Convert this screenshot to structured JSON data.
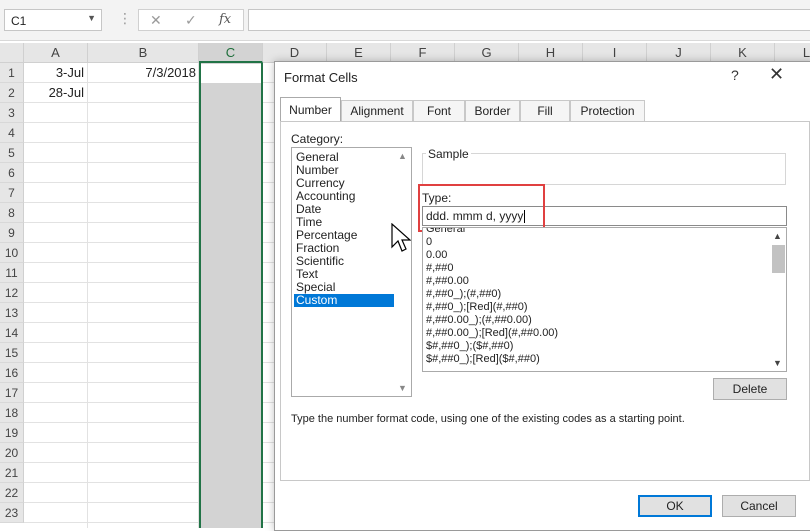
{
  "formula_bar": {
    "name_box": "C1",
    "dots": "⋮",
    "cancel_icon": "✕",
    "enter_icon": "✓",
    "fx_label": "fx",
    "formula_value": ""
  },
  "grid": {
    "columns": [
      "A",
      "B",
      "C",
      "D",
      "E",
      "F",
      "G",
      "H",
      "I",
      "J",
      "K",
      "L"
    ],
    "rows": [
      "1",
      "2",
      "3",
      "4",
      "5",
      "6",
      "7",
      "8",
      "9",
      "10",
      "11",
      "12",
      "13",
      "14",
      "15",
      "16",
      "17",
      "18",
      "19",
      "20",
      "21",
      "22",
      "23"
    ],
    "cells": {
      "A1": "3-Jul",
      "B1": "7/3/2018",
      "A2": "28-Jul"
    }
  },
  "dialog": {
    "title": "Format Cells",
    "help": "?",
    "close": "✕",
    "tabs": [
      {
        "label": "Number",
        "active": true
      },
      {
        "label": "Alignment"
      },
      {
        "label": "Font"
      },
      {
        "label": "Border"
      },
      {
        "label": "Fill"
      },
      {
        "label": "Protection"
      }
    ],
    "category_label": "Category:",
    "categories": [
      "General",
      "Number",
      "Currency",
      "Accounting",
      "Date",
      "Time",
      "Percentage",
      "Fraction",
      "Scientific",
      "Text",
      "Special",
      "Custom"
    ],
    "selected_category": "Custom",
    "sample_label": "Sample",
    "type_label": "Type:",
    "type_value": "ddd. mmm d, yyyy",
    "format_codes": [
      "General",
      "0",
      "0.00",
      "#,##0",
      "#,##0.00",
      "#,##0_);(#,##0)",
      "#,##0_);[Red](#,##0)",
      "#,##0.00_);(#,##0.00)",
      "#,##0.00_);[Red](#,##0.00)",
      "$#,##0_);($#,##0)",
      "$#,##0_);[Red]($#,##0)"
    ],
    "delete_label": "Delete",
    "description": "Type the number format code, using one of the existing codes as a starting point.",
    "ok_label": "OK",
    "cancel_label": "Cancel",
    "accent_color": "#0078d7",
    "highlight_color": "#e04040"
  },
  "sheet": {
    "selection_color": "#217346"
  }
}
